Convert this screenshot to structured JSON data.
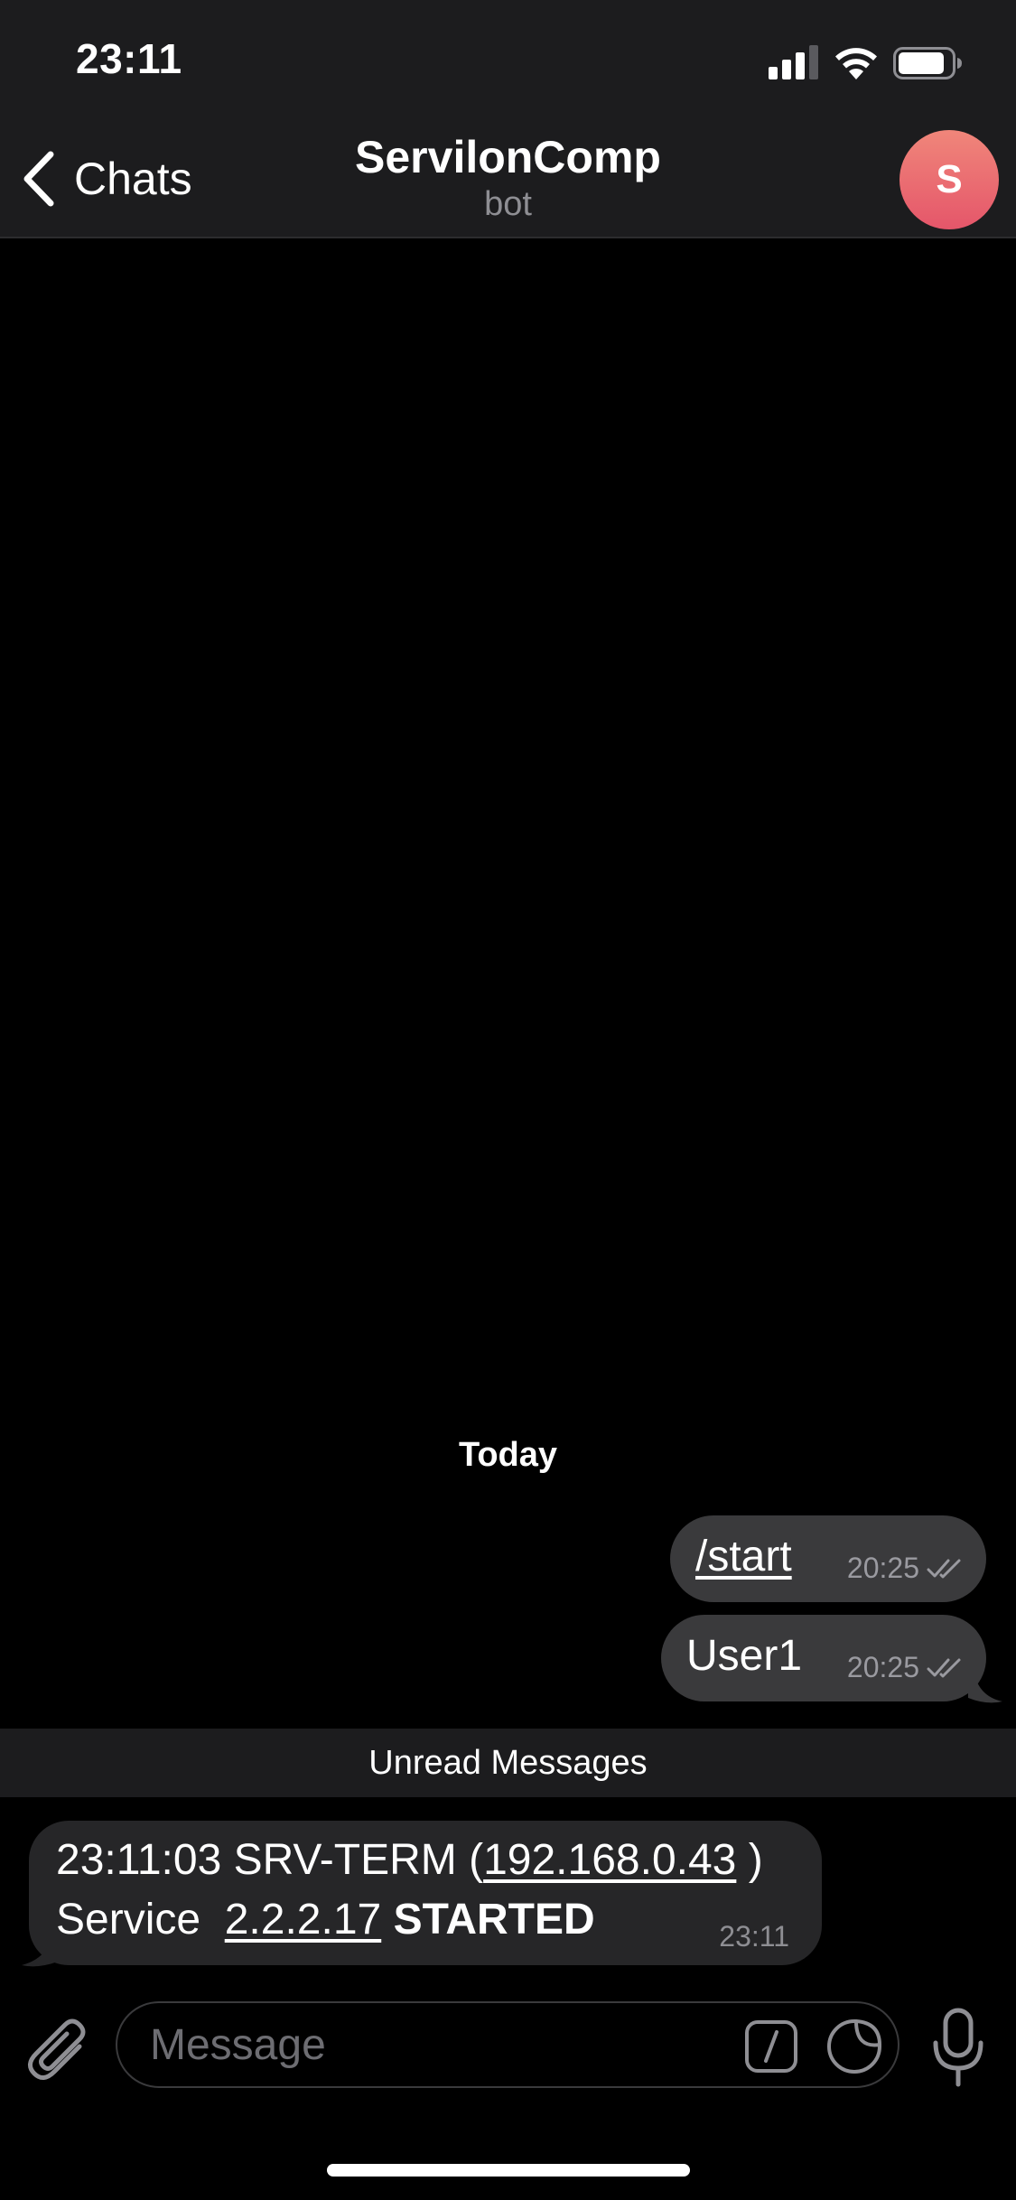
{
  "status_bar": {
    "time": "23:11"
  },
  "nav": {
    "back_label": "Chats",
    "title": "ServilonComp",
    "subtitle": "bot",
    "avatar_letter": "S"
  },
  "chat": {
    "date_separator": "Today",
    "outgoing": [
      {
        "text": "/start",
        "time": "20:25",
        "status": "read"
      },
      {
        "text": "User1",
        "time": "20:25",
        "status": "read"
      }
    ],
    "unread_label": "Unread Messages",
    "incoming": {
      "line1_prefix": "23:11:03 SRV-TERM (",
      "ip": "192.168.0.43",
      "line1_suffix": " )",
      "line2_prefix": "Service  ",
      "version": "2.2.2.17",
      "status_word": "STARTED",
      "time": "23:11"
    }
  },
  "composer": {
    "placeholder": "Message"
  },
  "icons": {
    "back": "chevron-left-icon",
    "attach": "paperclip-icon",
    "commands": "slash-command-icon",
    "sticker": "sticker-icon",
    "mic": "microphone-icon"
  },
  "colors": {
    "bar_background": "#1c1c1e",
    "outgoing_bubble": "#3a3a3c",
    "incoming_bubble": "#262628",
    "avatar_top": "#f0867a",
    "avatar_bottom": "#e5566a"
  }
}
